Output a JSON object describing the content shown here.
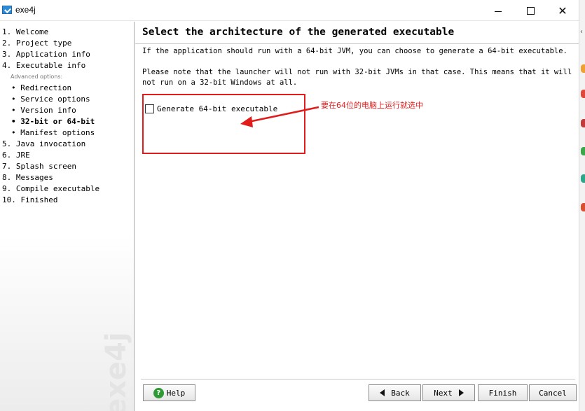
{
  "window": {
    "title": "exe4j",
    "minimize_icon": "minimize-icon",
    "maximize_icon": "maximize-icon",
    "close_icon": "close-icon"
  },
  "sidebar": {
    "steps": [
      {
        "label": "1. Welcome"
      },
      {
        "label": "2. Project type"
      },
      {
        "label": "3. Application info"
      },
      {
        "label": "4. Executable info"
      }
    ],
    "advanced_label": "Advanced options:",
    "sub_items": [
      {
        "label": "• Redirection",
        "active": false
      },
      {
        "label": "• Service options",
        "active": false
      },
      {
        "label": "• Version info",
        "active": false
      },
      {
        "label": "• 32-bit or 64-bit",
        "active": true
      },
      {
        "label": "• Manifest options",
        "active": false
      }
    ],
    "steps_after": [
      {
        "label": "5. Java invocation"
      },
      {
        "label": "6. JRE"
      },
      {
        "label": "7. Splash screen"
      },
      {
        "label": "8. Messages"
      },
      {
        "label": "9. Compile executable"
      },
      {
        "label": "10. Finished"
      }
    ],
    "watermark": "exe4j"
  },
  "main": {
    "heading": "Select the architecture of the generated executable",
    "paragraph1": "If the application should run with a 64-bit JVM, you can choose to generate a 64-bit executable.",
    "paragraph2": "Please note that the launcher will not run with 32-bit JVMs in that case. This means that it will not run on a 32-bit Windows at all.",
    "checkbox": {
      "label": "Generate 64-bit executable",
      "checked": false
    },
    "annotation": "要在64位的电脑上运行就选中",
    "annotation_color": "#e21b1b"
  },
  "buttons": {
    "help": "Help",
    "back": "Back",
    "next": "Next",
    "finish": "Finish",
    "cancel": "Cancel",
    "help_icon": "help-icon"
  }
}
